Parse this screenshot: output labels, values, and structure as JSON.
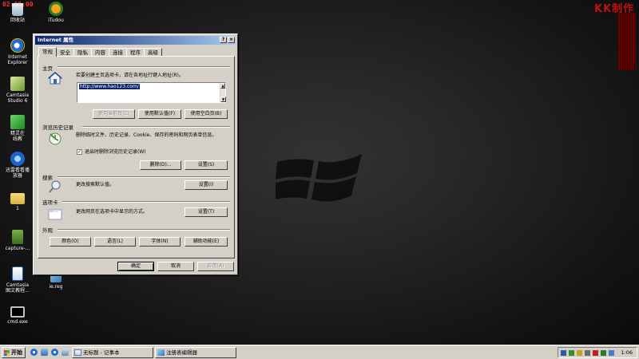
{
  "overlay": {
    "recording_time": "02:00:00",
    "watermark": "KK制作"
  },
  "desktop_icons": [
    {
      "id": "recycle-bin",
      "label": "回收站"
    },
    {
      "id": "itudou",
      "label": "iTudou"
    },
    {
      "id": "internet-explorer",
      "label": "Internet\nExplorer"
    },
    {
      "id": "camtasia-studio",
      "label": "Camtasia\nStudio 6"
    },
    {
      "id": "sprite",
      "label": "精灵在\n线教"
    },
    {
      "id": "xunlei-player",
      "label": "迅雷看看播\n放器"
    },
    {
      "id": "folder-1",
      "label": "1"
    },
    {
      "id": "capture",
      "label": "capture-..."
    },
    {
      "id": "camtasia-tutorial",
      "label": "Camtasia\n图文教程..."
    },
    {
      "id": "ie-reg",
      "label": "ie.reg"
    },
    {
      "id": "cmd",
      "label": "cmd.exe"
    }
  ],
  "dialog": {
    "title": "Internet 属性",
    "help_btn": "?",
    "close_btn": "×",
    "tabs": [
      "常规",
      "安全",
      "隐私",
      "内容",
      "连接",
      "程序",
      "高级"
    ],
    "homepage": {
      "group": "主页",
      "desc": "若要创建主页选项卡，请在各地址行键入地址(R)。",
      "url": "http://www.hao123.com/",
      "btn_current": "使用当前页(C)",
      "btn_default": "使用默认值(F)",
      "btn_blank": "使用空白页(B)"
    },
    "history": {
      "group": "浏览历史记录",
      "desc": "删除临时文件、历史记录、Cookie、保存的密码和网页表单信息。",
      "checkbox_label": "退出时删除浏览历史记录(W)",
      "checked": true,
      "btn_delete": "删除(D)...",
      "btn_settings": "设置(S)"
    },
    "search": {
      "group": "搜索",
      "desc": "更改搜索默认值。",
      "btn_settings": "设置(I)"
    },
    "tabs_group": {
      "group": "选项卡",
      "desc": "更改网页在选项卡中显示的方式。",
      "btn_settings": "设置(T)"
    },
    "appearance": {
      "group": "外观",
      "btn_colors": "颜色(O)",
      "btn_languages": "语言(L)",
      "btn_fonts": "字体(N)",
      "btn_accessibility": "辅助功能(E)"
    },
    "footer": {
      "ok": "确定",
      "cancel": "取消",
      "apply": "应用(A)"
    }
  },
  "taskbar": {
    "start": "开始",
    "tasks": [
      {
        "label": "无标题 - 记事本"
      },
      {
        "label": "注册表编辑器"
      }
    ],
    "clock": "1:06"
  }
}
